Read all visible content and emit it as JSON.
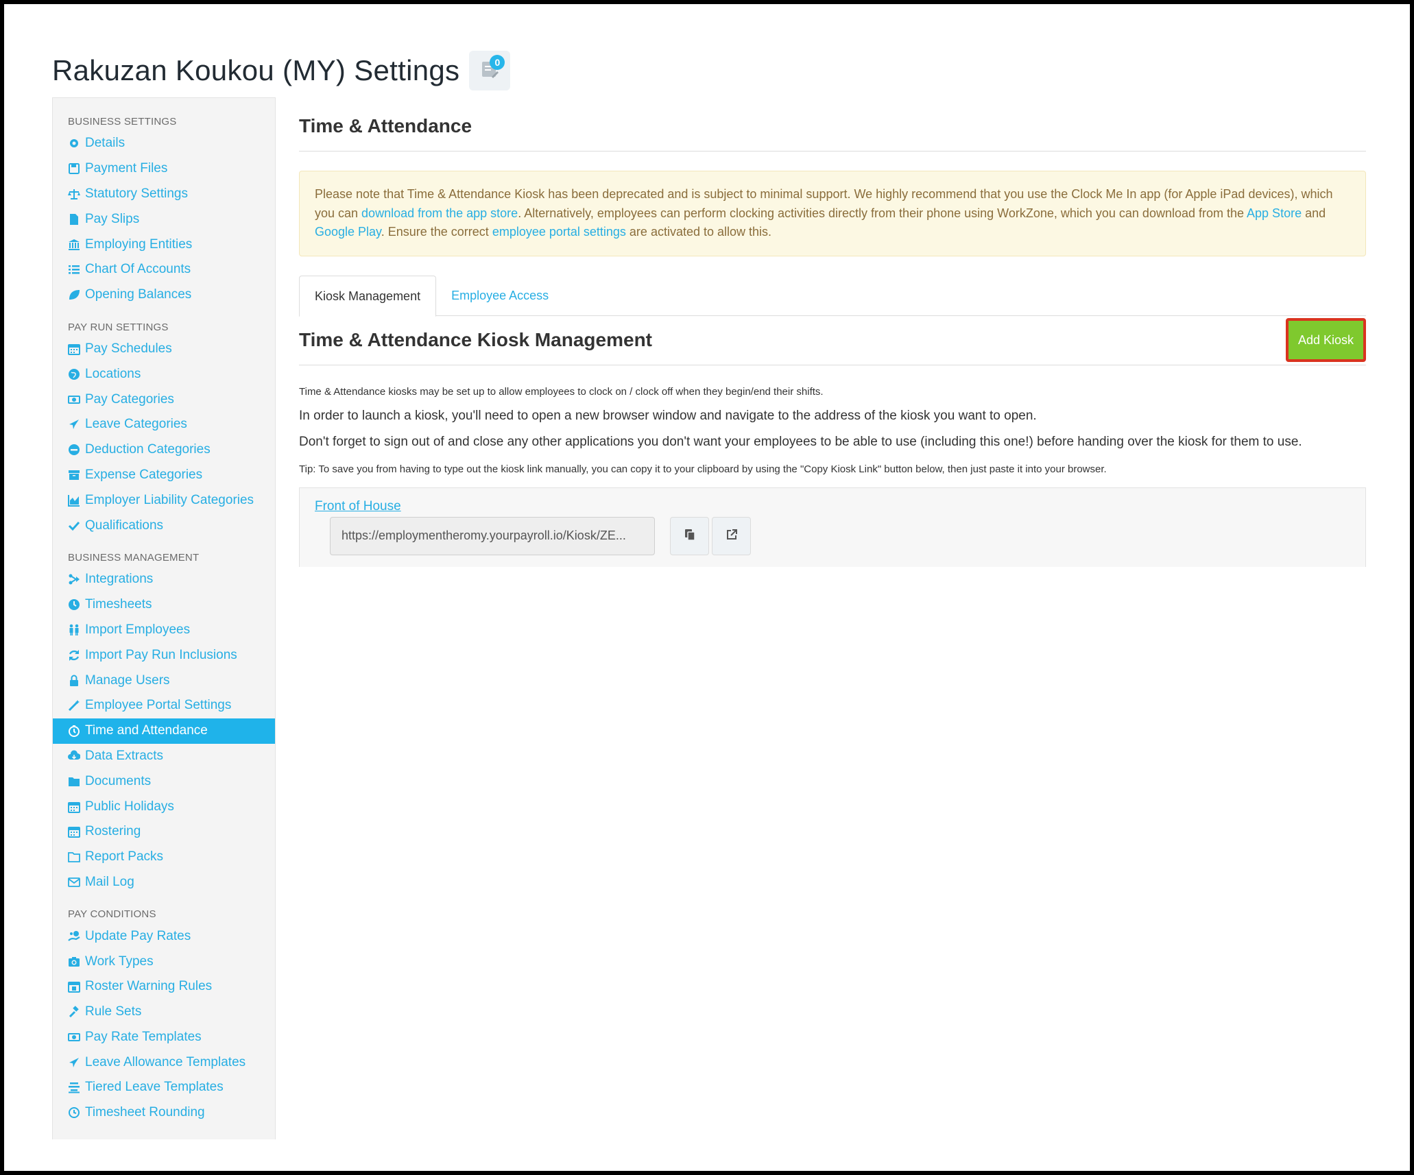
{
  "header": {
    "title": "Rakuzan Koukou (MY) Settings",
    "notes_count": "0"
  },
  "sidebar": {
    "sections": [
      {
        "title": "BUSINESS SETTINGS",
        "items": [
          {
            "label": "Details",
            "icon": "gear-icon"
          },
          {
            "label": "Payment Files",
            "icon": "save-icon"
          },
          {
            "label": "Statutory Settings",
            "icon": "scale-icon"
          },
          {
            "label": "Pay Slips",
            "icon": "file-icon"
          },
          {
            "label": "Employing Entities",
            "icon": "bank-icon"
          },
          {
            "label": "Chart Of Accounts",
            "icon": "list-icon"
          },
          {
            "label": "Opening Balances",
            "icon": "leaf-icon"
          }
        ]
      },
      {
        "title": "PAY RUN SETTINGS",
        "items": [
          {
            "label": "Pay Schedules",
            "icon": "calendar-icon"
          },
          {
            "label": "Locations",
            "icon": "globe-icon"
          },
          {
            "label": "Pay Categories",
            "icon": "money-icon"
          },
          {
            "label": "Leave Categories",
            "icon": "plane-icon"
          },
          {
            "label": "Deduction Categories",
            "icon": "minus-circle-icon"
          },
          {
            "label": "Expense Categories",
            "icon": "archive-icon"
          },
          {
            "label": "Employer Liability Categories",
            "icon": "area-chart-icon"
          },
          {
            "label": "Qualifications",
            "icon": "check-icon"
          }
        ]
      },
      {
        "title": "BUSINESS MANAGEMENT",
        "items": [
          {
            "label": "Integrations",
            "icon": "integration-icon"
          },
          {
            "label": "Timesheets",
            "icon": "clock-icon"
          },
          {
            "label": "Import Employees",
            "icon": "users-icon"
          },
          {
            "label": "Import Pay Run Inclusions",
            "icon": "refresh-icon"
          },
          {
            "label": "Manage Users",
            "icon": "lock-icon"
          },
          {
            "label": "Employee Portal Settings",
            "icon": "wand-icon"
          },
          {
            "label": "Time and Attendance",
            "icon": "stopwatch-icon",
            "active": true
          },
          {
            "label": "Data Extracts",
            "icon": "cloud-download-icon"
          },
          {
            "label": "Documents",
            "icon": "folder-icon"
          },
          {
            "label": "Public Holidays",
            "icon": "calendar-icon"
          },
          {
            "label": "Rostering",
            "icon": "calendar-icon"
          },
          {
            "label": "Report Packs",
            "icon": "folder-open-icon"
          },
          {
            "label": "Mail Log",
            "icon": "envelope-icon"
          }
        ]
      },
      {
        "title": "PAY CONDITIONS",
        "items": [
          {
            "label": "Update Pay Rates",
            "icon": "hand-money-icon"
          },
          {
            "label": "Work Types",
            "icon": "camera-icon"
          },
          {
            "label": "Roster Warning Rules",
            "icon": "calendar-alert-icon"
          },
          {
            "label": "Rule Sets",
            "icon": "gavel-icon"
          },
          {
            "label": "Pay Rate Templates",
            "icon": "money-icon"
          },
          {
            "label": "Leave Allowance Templates",
            "icon": "plane-icon"
          },
          {
            "label": "Tiered Leave Templates",
            "icon": "tiers-icon"
          },
          {
            "label": "Timesheet Rounding",
            "icon": "clock-outline-icon"
          }
        ]
      }
    ]
  },
  "main": {
    "title": "Time & Attendance",
    "alert": {
      "p1": "Please note that Time & Attendance Kiosk has been deprecated and is subject to minimal support. We highly recommend that you use the Clock Me In app (for Apple iPad devices), which you can ",
      "link1": "download from the app store",
      "p2": ". Alternatively, employees can perform clocking activities directly from their phone using WorkZone, which you can download from the ",
      "link2": "App Store",
      "p3": " and ",
      "link3": "Google Play",
      "p4": ". Ensure the correct ",
      "link4": "employee portal settings",
      "p5": " are activated to allow this."
    },
    "tabs": [
      {
        "label": "Kiosk Management",
        "active": true
      },
      {
        "label": "Employee Access",
        "active": false
      }
    ],
    "kiosk_title": "Time & Attendance Kiosk Management",
    "add_button": "Add Kiosk",
    "intro_small": "Time & Attendance kiosks may be set up to allow employees to clock on / clock off when they begin/end their shifts.",
    "intro_1": "In order to launch a kiosk, you'll need to open a new browser window and navigate to the address of the kiosk you want to open.",
    "intro_2": "Don't forget to sign out of and close any other applications you don't want your employees to be able to use (including this one!) before handing over the kiosk for them to use.",
    "tip": "Tip: To save you from having to type out the kiosk link manually, you can copy it to your clipboard by using the \"Copy Kiosk Link\" button below, then just paste it into your browser.",
    "kiosk": {
      "name": "Front of House",
      "url": "https://employmentheromy.yourpayroll.io/Kiosk/ZE..."
    }
  },
  "colors": {
    "link": "#27aee3",
    "active_nav": "#1fb3ea",
    "add_button": "#7fc92e",
    "highlight": "#d9341f"
  }
}
